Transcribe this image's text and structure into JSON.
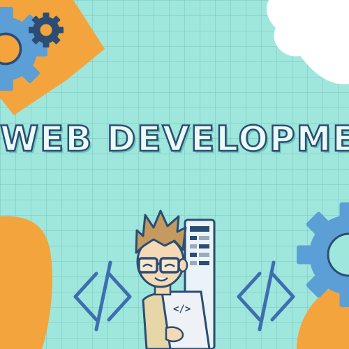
{
  "title": "WEB DEVELOPMENT",
  "code_symbol": "</>",
  "colors": {
    "background": "#9fe6dc",
    "orange": "#f3a43c",
    "gear_blue": "#5b9fd6",
    "gear_dark": "#2b4d74",
    "outline": "#2b4d74",
    "white_cloud": "#ffffff"
  },
  "icons": [
    "gear-icon",
    "code-bracket-icon",
    "developer-illustration",
    "phone-mockup-icon"
  ]
}
